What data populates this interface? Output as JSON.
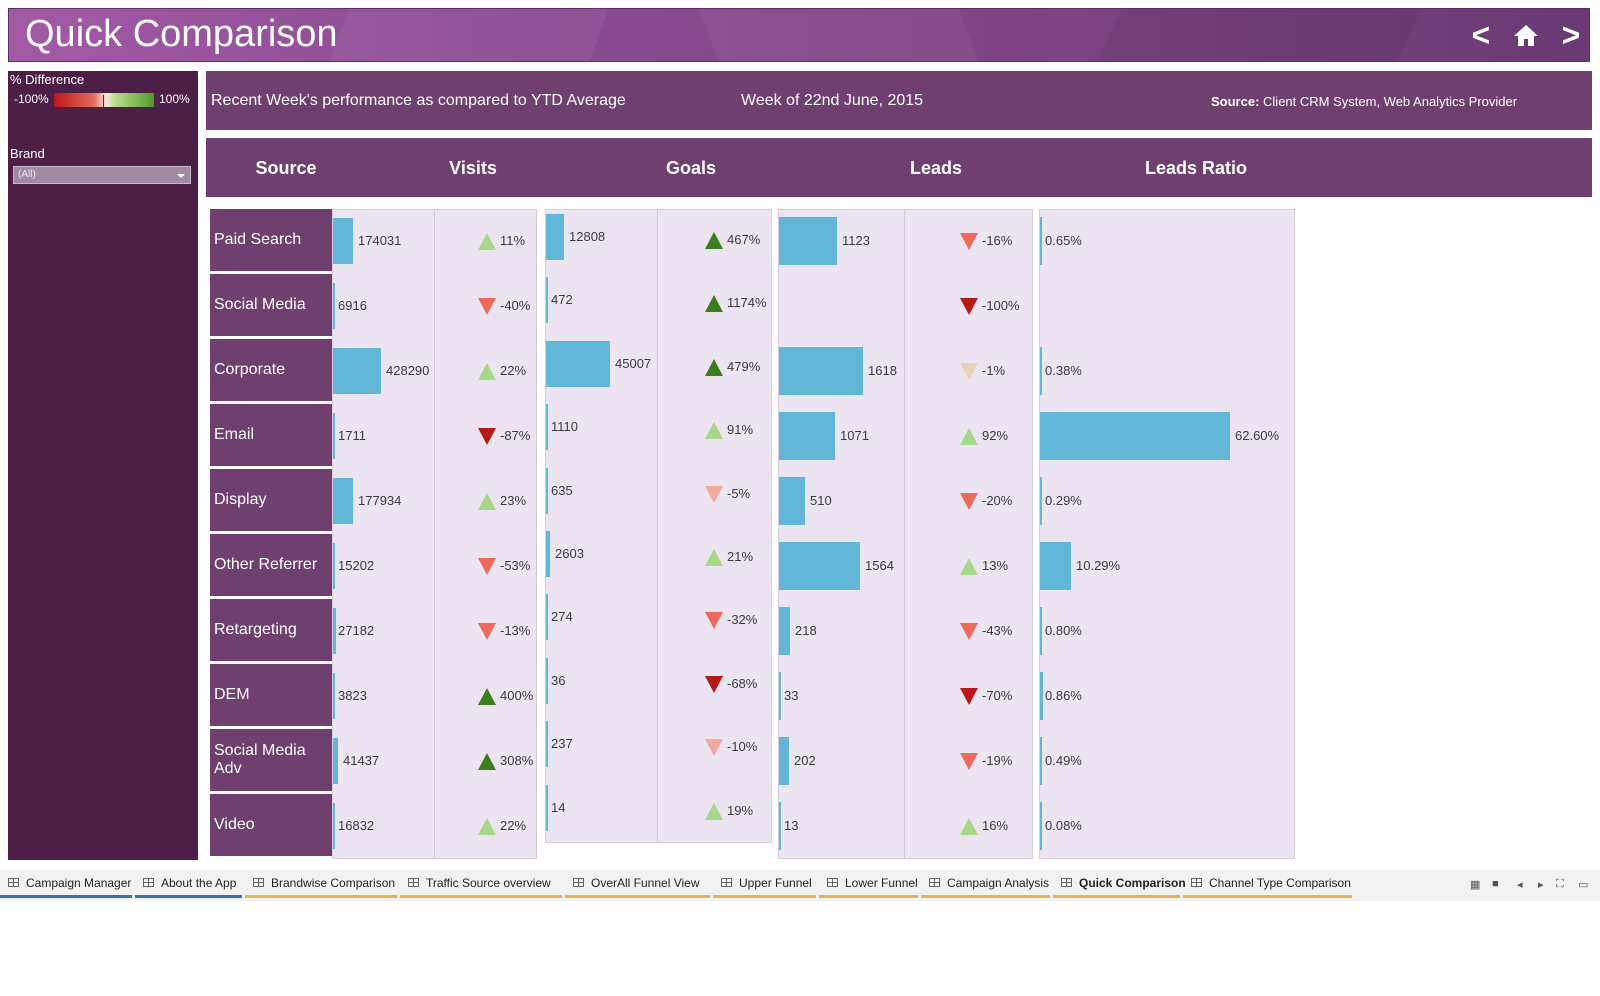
{
  "header": {
    "title": "Quick Comparison",
    "prev_label": "<",
    "next_label": ">",
    "home_icon": "home-icon"
  },
  "left_panel": {
    "legend_title": "% Difference",
    "legend_min": "-100%",
    "legend_max": "100%",
    "brand_label": "Brand",
    "brand_value": "(All)"
  },
  "info": {
    "description": "Recent Week's performance as compared to YTD Average",
    "week": "Week of 22nd June, 2015",
    "source_label": "Source:",
    "source_value": "Client CRM System, Web Analytics Provider"
  },
  "columns": {
    "source": "Source",
    "visits": "Visits",
    "goals": "Goals",
    "leads": "Leads",
    "leads_ratio": "Leads Ratio"
  },
  "colors": {
    "bar": "#62b6d8",
    "up_strong": "#3d7d1e",
    "up_light": "#a8d88a",
    "down_strong": "#b81818",
    "down_mid": "#ee6a5c",
    "down_light": "#f4a99f",
    "neutral": "#ead3b3",
    "header_purple": "#6f3f70",
    "panel_bg": "#ede4f1"
  },
  "chart_data": {
    "type": "bar",
    "categories": [
      "Paid Search",
      "Social Media",
      "Corporate",
      "Email",
      "Display",
      "Other Referrer",
      "Retargeting",
      "DEM",
      "Social Media Adv",
      "Video"
    ],
    "series": [
      {
        "name": "Visits",
        "values": [
          174031,
          6916,
          428290,
          1711,
          177934,
          15202,
          27182,
          3823,
          41437,
          16832
        ],
        "labels": [
          "174031",
          "6916",
          "428290",
          "1711",
          "177934",
          "15202",
          "27182",
          "3823",
          "41437",
          "16832"
        ],
        "pct": [
          "11%",
          "-40%",
          "22%",
          "-87%",
          "23%",
          "-53%",
          "-13%",
          "400%",
          "308%",
          "22%"
        ],
        "pct_values": [
          11,
          -40,
          22,
          -87,
          23,
          -53,
          -13,
          400,
          308,
          22
        ]
      },
      {
        "name": "Goals",
        "values": [
          12808,
          472,
          45007,
          1110,
          635,
          2603,
          274,
          36,
          237,
          14
        ],
        "labels": [
          "12808",
          "472",
          "45007",
          "1110",
          "635",
          "2603",
          "274",
          "36",
          "237",
          "14"
        ],
        "pct": [
          "467%",
          "1174%",
          "479%",
          "91%",
          "-5%",
          "21%",
          "-32%",
          "-68%",
          "-10%",
          "19%"
        ],
        "pct_values": [
          467,
          1174,
          479,
          91,
          -5,
          21,
          -32,
          -68,
          -10,
          19
        ]
      },
      {
        "name": "Leads",
        "values": [
          1123,
          0,
          1618,
          1071,
          510,
          1564,
          218,
          33,
          202,
          13
        ],
        "labels": [
          "1123",
          "",
          "1618",
          "1071",
          "510",
          "1564",
          "218",
          "33",
          "202",
          "13"
        ],
        "pct": [
          "-16%",
          "-100%",
          "-1%",
          "92%",
          "-20%",
          "13%",
          "-43%",
          "-70%",
          "-19%",
          "16%"
        ],
        "pct_values": [
          -16,
          -100,
          -1,
          92,
          -20,
          13,
          -43,
          -70,
          -19,
          16
        ]
      },
      {
        "name": "Leads Ratio",
        "values": [
          0.65,
          null,
          0.38,
          62.6,
          0.29,
          10.29,
          0.8,
          0.86,
          0.49,
          0.08
        ],
        "labels": [
          "0.65%",
          "",
          "0.38%",
          "62.60%",
          "0.29%",
          "10.29%",
          "0.80%",
          "0.86%",
          "0.49%",
          "0.08%"
        ]
      }
    ]
  },
  "tabs": [
    {
      "label": "Campaign Manager",
      "color": "#3d6fa6",
      "active": false
    },
    {
      "label": "About the App",
      "color": "#3d6fa6",
      "active": false
    },
    {
      "label": "Brandwise Comparison",
      "color": "#e0b45a",
      "active": false
    },
    {
      "label": "Traffic Source overview",
      "color": "#e0b45a",
      "active": false
    },
    {
      "label": "OverAll Funnel View",
      "color": "#e0b45a",
      "active": false
    },
    {
      "label": "Upper Funnel",
      "color": "#e0b45a",
      "active": false
    },
    {
      "label": "Lower Funnel",
      "color": "#e0b45a",
      "active": false
    },
    {
      "label": "Campaign Analysis",
      "color": "#e0b45a",
      "active": false
    },
    {
      "label": "Quick Comparison",
      "color": "#e0b45a",
      "active": true
    },
    {
      "label": "Channel Type Comparison",
      "color": "#e0b45a",
      "active": false
    }
  ]
}
